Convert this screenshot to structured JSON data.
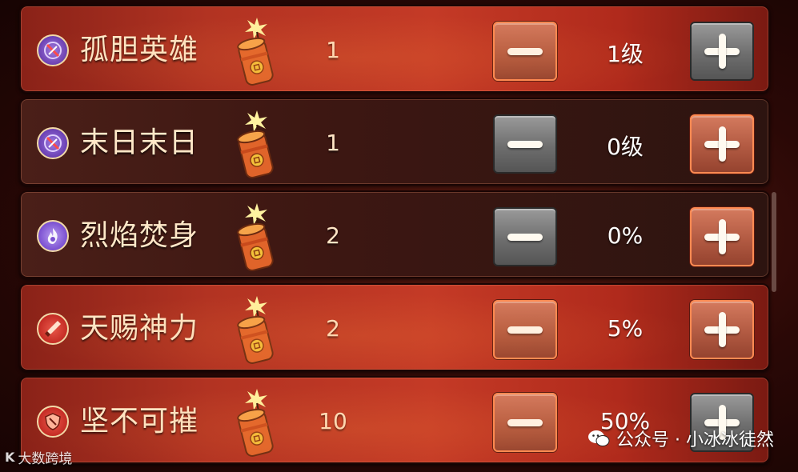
{
  "rows": [
    {
      "name": "孤胆英雄",
      "cost": "1",
      "level": "1级",
      "state": "active",
      "minus": "red",
      "plus": "gray",
      "icon": "crossed-sword-icon",
      "icon_color": "#6a3fb3"
    },
    {
      "name": "末日末日",
      "cost": "1",
      "level": "0级",
      "state": "inactive",
      "minus": "gray",
      "plus": "red",
      "icon": "crossed-sword-icon",
      "icon_color": "#6a3fb3"
    },
    {
      "name": "烈焰焚身",
      "cost": "2",
      "level": "0%",
      "state": "inactive",
      "minus": "gray",
      "plus": "red",
      "icon": "flame-icon",
      "icon_color": "#7a4fd0"
    },
    {
      "name": "天赐神力",
      "cost": "2",
      "level": "5%",
      "state": "active",
      "minus": "red",
      "plus": "red",
      "icon": "sword-icon",
      "icon_color": "#c42a24"
    },
    {
      "name": "坚不可摧",
      "cost": "10",
      "level": "50%",
      "state": "active",
      "minus": "red",
      "plus": "gray",
      "icon": "shield-icon",
      "icon_color": "#c42a24"
    }
  ],
  "watermark": {
    "left": "大数跨境",
    "right": "公众号 · 小冰冰徒然"
  },
  "colors": {
    "active_row": "#b23322",
    "inactive_row": "#3d1712",
    "accent_orange": "#ff8a52"
  }
}
